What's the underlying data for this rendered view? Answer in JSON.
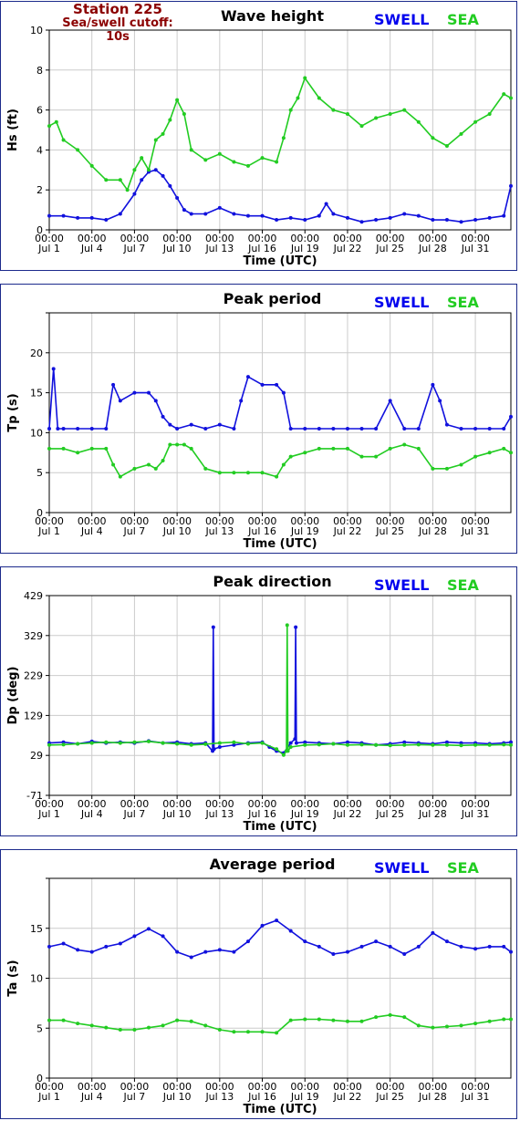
{
  "station": {
    "name": "Station 225",
    "cutoff": "Sea/swell cutoff: 10s"
  },
  "legend": {
    "swell": "SWELL",
    "sea": "SEA",
    "swell_color": "#1111dd",
    "sea_color": "#22cc22"
  },
  "x_axis": {
    "label": "Time (UTC)",
    "range_days": [
      0,
      32.5
    ],
    "ticks": [
      {
        "day": 0,
        "time": "00:00",
        "date": "Jul 1"
      },
      {
        "day": 3,
        "time": "00:00",
        "date": "Jul 4"
      },
      {
        "day": 6,
        "time": "00:00",
        "date": "Jul 7"
      },
      {
        "day": 9,
        "time": "00:00",
        "date": "Jul 10"
      },
      {
        "day": 12,
        "time": "00:00",
        "date": "Jul 13"
      },
      {
        "day": 15,
        "time": "00:00",
        "date": "Jul 16"
      },
      {
        "day": 18,
        "time": "00:00",
        "date": "Jul 19"
      },
      {
        "day": 21,
        "time": "00:00",
        "date": "Jul 22"
      },
      {
        "day": 24,
        "time": "00:00",
        "date": "Jul 25"
      },
      {
        "day": 27,
        "time": "00:00",
        "date": "Jul 28"
      },
      {
        "day": 30,
        "time": "00:00",
        "date": "Jul 31"
      }
    ]
  },
  "chart_data": [
    {
      "type": "line",
      "title": "Wave height",
      "ylabel": "Hs (ft)",
      "ylim": [
        0,
        10
      ],
      "yticks": [
        "0",
        "2",
        "4",
        "6",
        "8",
        "10"
      ],
      "grid": true,
      "series": [
        {
          "name": "SWELL",
          "x": [
            0,
            1,
            2,
            3,
            4,
            5,
            6,
            6.5,
            7,
            7.5,
            8,
            8.5,
            9,
            9.5,
            10,
            11,
            12,
            13,
            14,
            15,
            16,
            17,
            18,
            19,
            19.5,
            20,
            21,
            22,
            23,
            24,
            25,
            26,
            27,
            28,
            29,
            30,
            31,
            32,
            32.5
          ],
          "values": [
            0.7,
            0.7,
            0.6,
            0.6,
            0.5,
            0.8,
            1.8,
            2.5,
            2.9,
            3.0,
            2.7,
            2.2,
            1.6,
            1.0,
            0.8,
            0.8,
            1.1,
            0.8,
            0.7,
            0.7,
            0.5,
            0.6,
            0.5,
            0.7,
            1.3,
            0.8,
            0.6,
            0.4,
            0.5,
            0.6,
            0.8,
            0.7,
            0.5,
            0.5,
            0.4,
            0.5,
            0.6,
            0.7,
            2.2
          ]
        },
        {
          "name": "SEA",
          "x": [
            0,
            0.5,
            1,
            2,
            3,
            4,
            5,
            5.5,
            6,
            6.5,
            7,
            7.5,
            8,
            8.5,
            9,
            9.5,
            10,
            11,
            12,
            13,
            14,
            15,
            16,
            16.5,
            17,
            17.5,
            18,
            19,
            20,
            21,
            22,
            23,
            24,
            25,
            26,
            27,
            28,
            29,
            30,
            31,
            32,
            32.5
          ],
          "values": [
            5.2,
            5.4,
            4.5,
            4.0,
            3.2,
            2.5,
            2.5,
            2.0,
            3.0,
            3.6,
            3.0,
            4.5,
            4.8,
            5.5,
            6.5,
            5.8,
            4.0,
            3.5,
            3.8,
            3.4,
            3.2,
            3.6,
            3.4,
            4.6,
            6.0,
            6.6,
            7.6,
            6.6,
            6.0,
            5.8,
            5.2,
            5.6,
            5.8,
            6.0,
            5.4,
            4.6,
            4.2,
            4.8,
            5.4,
            5.8,
            6.8,
            6.6
          ]
        }
      ]
    },
    {
      "type": "line",
      "title": "Peak period",
      "ylabel": "Tp (s)",
      "ylim": [
        0,
        25
      ],
      "yticks": [
        "0",
        "5",
        "10",
        "15",
        "20",
        ""
      ],
      "grid": true,
      "series": [
        {
          "name": "SWELL",
          "x": [
            0,
            0.3,
            0.6,
            1,
            2,
            3,
            4,
            4.5,
            5,
            6,
            7,
            7.5,
            8,
            8.5,
            9,
            10,
            11,
            12,
            13,
            13.5,
            14,
            15,
            16,
            16.5,
            17,
            18,
            19,
            20,
            21,
            22,
            23,
            24,
            25,
            26,
            27,
            27.5,
            28,
            29,
            30,
            31,
            32,
            32.5
          ],
          "values": [
            10.5,
            18,
            10.5,
            10.5,
            10.5,
            10.5,
            10.5,
            16,
            14,
            15,
            15,
            14,
            12,
            11,
            10.5,
            11,
            10.5,
            11,
            10.5,
            14,
            17,
            16,
            16,
            15,
            10.5,
            10.5,
            10.5,
            10.5,
            10.5,
            10.5,
            10.5,
            14,
            10.5,
            10.5,
            16,
            14,
            11,
            10.5,
            10.5,
            10.5,
            10.5,
            12
          ]
        },
        {
          "name": "SEA",
          "x": [
            0,
            1,
            2,
            3,
            4,
            4.5,
            5,
            6,
            7,
            7.5,
            8,
            8.5,
            9,
            9.5,
            10,
            11,
            12,
            13,
            14,
            15,
            16,
            16.5,
            17,
            18,
            19,
            20,
            21,
            22,
            23,
            24,
            25,
            26,
            27,
            28,
            29,
            30,
            31,
            32,
            32.5
          ],
          "values": [
            8,
            8,
            7.5,
            8,
            8,
            6,
            4.5,
            5.5,
            6,
            5.5,
            6.5,
            8.5,
            8.5,
            8.5,
            8,
            5.5,
            5,
            5,
            5,
            5,
            4.5,
            6,
            7,
            7.5,
            8,
            8,
            8,
            7,
            7,
            8,
            8.5,
            8,
            5.5,
            5.5,
            6,
            7,
            7.5,
            8,
            7.5
          ]
        }
      ]
    },
    {
      "type": "line",
      "title": "Peak direction",
      "ylabel": "Dp (deg)",
      "ylim": [
        -71,
        429
      ],
      "yticks": [
        "-71",
        "29",
        "129",
        "229",
        "329",
        "429"
      ],
      "grid": true,
      "series": [
        {
          "name": "SWELL",
          "x": [
            0,
            1,
            2,
            3,
            4,
            5,
            6,
            7,
            8,
            9,
            10,
            11,
            11.5,
            11.55,
            11.6,
            12,
            13,
            14,
            15,
            15.5,
            16,
            16.5,
            17,
            17.3,
            17.35,
            17.4,
            18,
            19,
            20,
            21,
            22,
            23,
            24,
            25,
            26,
            27,
            28,
            29,
            30,
            31,
            32,
            32.5
          ],
          "values": [
            60,
            62,
            58,
            64,
            60,
            62,
            60,
            65,
            60,
            62,
            58,
            60,
            40,
            350,
            45,
            50,
            55,
            60,
            62,
            50,
            40,
            35,
            60,
            70,
            350,
            60,
            62,
            60,
            58,
            62,
            60,
            55,
            58,
            62,
            60,
            58,
            62,
            60,
            60,
            58,
            60,
            62
          ]
        },
        {
          "name": "SEA",
          "x": [
            0,
            1,
            2,
            3,
            4,
            5,
            6,
            7,
            8,
            9,
            10,
            11,
            12,
            13,
            14,
            15,
            16,
            16.5,
            16.7,
            16.75,
            16.8,
            17,
            18,
            19,
            20,
            21,
            22,
            23,
            24,
            25,
            26,
            27,
            28,
            29,
            30,
            31,
            32,
            32.5
          ],
          "values": [
            55,
            56,
            58,
            60,
            62,
            60,
            62,
            64,
            60,
            58,
            55,
            57,
            60,
            62,
            58,
            60,
            45,
            30,
            40,
            355,
            40,
            50,
            55,
            56,
            58,
            55,
            56,
            55,
            54,
            55,
            56,
            55,
            55,
            54,
            55,
            55,
            56,
            55
          ]
        }
      ]
    },
    {
      "type": "line",
      "title": "Average period",
      "ylabel": "Ta (s)",
      "ylim": [
        0,
        19
      ],
      "yticks": [
        "0",
        "5",
        "10",
        "15",
        ""
      ],
      "grid": true,
      "series": [
        {
          "name": "SWELL",
          "x": [
            0,
            1,
            2,
            3,
            4,
            5,
            6,
            7,
            8,
            9,
            10,
            11,
            12,
            13,
            14,
            15,
            16,
            17,
            18,
            19,
            20,
            21,
            22,
            23,
            24,
            25,
            26,
            27,
            28,
            29,
            30,
            31,
            32,
            32.5
          ],
          "values": [
            12.5,
            12.8,
            12.2,
            12.0,
            12.5,
            12.8,
            13.5,
            14.2,
            13.5,
            12.0,
            11.5,
            12.0,
            12.2,
            12.0,
            13.0,
            14.5,
            15.0,
            14.0,
            13.0,
            12.5,
            11.8,
            12.0,
            12.5,
            13.0,
            12.5,
            11.8,
            12.5,
            13.8,
            13.0,
            12.5,
            12.3,
            12.5,
            12.5,
            12.0
          ]
        },
        {
          "name": "SEA",
          "x": [
            0,
            1,
            2,
            3,
            4,
            5,
            6,
            7,
            8,
            9,
            10,
            11,
            12,
            13,
            14,
            15,
            16,
            17,
            18,
            19,
            20,
            21,
            22,
            23,
            24,
            25,
            26,
            27,
            28,
            29,
            30,
            31,
            32,
            32.5
          ],
          "values": [
            5.5,
            5.5,
            5.2,
            5.0,
            4.8,
            4.6,
            4.6,
            4.8,
            5.0,
            5.5,
            5.4,
            5.0,
            4.6,
            4.4,
            4.4,
            4.4,
            4.3,
            5.5,
            5.6,
            5.6,
            5.5,
            5.4,
            5.4,
            5.8,
            6.0,
            5.8,
            5.0,
            4.8,
            4.9,
            5.0,
            5.2,
            5.4,
            5.6,
            5.6
          ]
        }
      ]
    }
  ]
}
